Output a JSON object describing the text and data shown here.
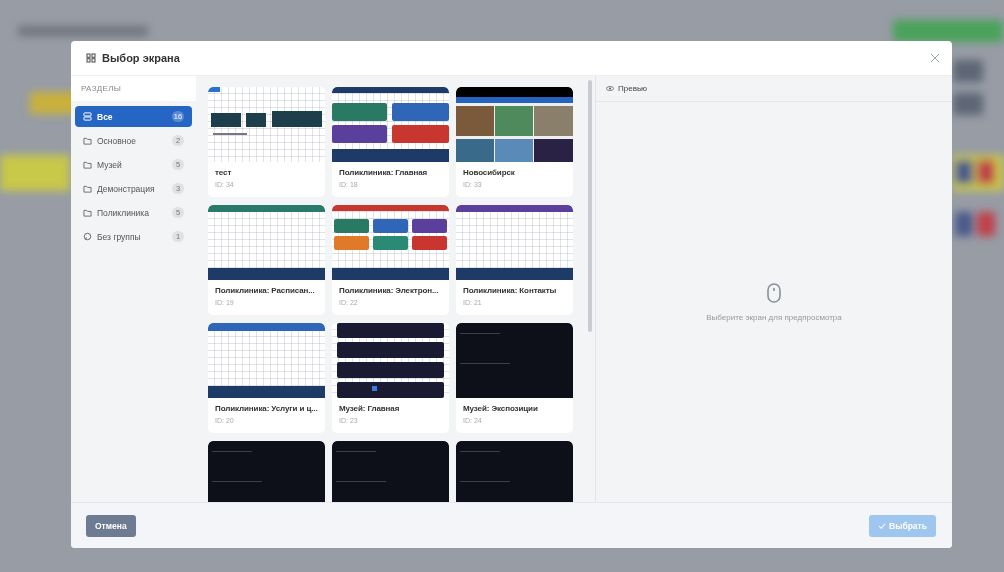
{
  "dialog": {
    "title": "Выбор экрана"
  },
  "sidebar": {
    "heading": "РАЗДЕЛЫ",
    "items": [
      {
        "kind": "all",
        "label": "Все",
        "count": "16",
        "selected": true
      },
      {
        "kind": "group",
        "label": "Основное",
        "count": "2",
        "selected": false
      },
      {
        "kind": "group",
        "label": "Музей",
        "count": "5",
        "selected": false
      },
      {
        "kind": "group",
        "label": "Демонстрация",
        "count": "3",
        "selected": false
      },
      {
        "kind": "group",
        "label": "Поликлиника",
        "count": "5",
        "selected": false
      },
      {
        "kind": "ungrouped",
        "label": "Без группы",
        "count": "1",
        "selected": false
      }
    ]
  },
  "screens": [
    {
      "kind": "sign",
      "title": "тест",
      "id": "ID: 34"
    },
    {
      "kind": "tiles4",
      "title": "Поликлиника: Главная",
      "id": "ID: 18"
    },
    {
      "kind": "photos",
      "title": "Новосибирск",
      "id": "ID: 33"
    },
    {
      "kind": "gridteal",
      "title": "Поликлиника: Расписан...",
      "id": "ID: 19"
    },
    {
      "kind": "tiles6",
      "title": "Поликлиника: Электрон...",
      "id": "ID: 22"
    },
    {
      "kind": "gridpurple",
      "title": "Поликлиника: Контакты",
      "id": "ID: 21"
    },
    {
      "kind": "gridblue",
      "title": "Поликлиника: Услуги и ц...",
      "id": "ID: 20"
    },
    {
      "kind": "darklist",
      "title": "Музей: Главная",
      "id": "ID: 23"
    },
    {
      "kind": "dark",
      "title": "Музей: Экспозиции",
      "id": "ID: 24"
    },
    {
      "kind": "dark"
    },
    {
      "kind": "dark"
    },
    {
      "kind": "dark"
    }
  ],
  "preview": {
    "heading": "Превью",
    "empty_text": "Выберите экран для предпросмотра"
  },
  "footer": {
    "cancel": "Отмена",
    "select": {
      "label": "Выбрать",
      "disabled": true
    }
  }
}
